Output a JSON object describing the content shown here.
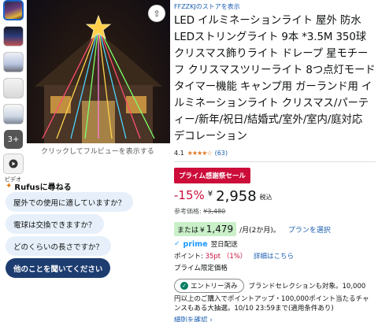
{
  "thumbnails": {
    "more_count": "3+",
    "video_label": "ビデオ"
  },
  "main_image": {
    "caption": "クリックしてフルビューを表示する"
  },
  "rufus": {
    "title": "Rufusに尋ねる",
    "questions": [
      "屋外での使用に適していますか？",
      "電球は交換できますか？",
      "どのくらいの長さですか？"
    ],
    "ask_other": "他のことを聞いてください"
  },
  "product": {
    "store_link": "FFZZKJのストアを表示",
    "title": "LED イルミネーションライト 屋外 防水 LEDストリングライト 9本 *3.5M 350球 クリスマス飾りライト ドレープ 星モチーフ クリスマスツリーライト 8つ点灯モード タイマー機能 キャンプ用 ガーランド用 イルミネーションライト クリスマス/パーティー/新年/祝日/結婚式/室外/室内/庭対応 デコレーション",
    "rating": "4.1",
    "stars_icon": "★★★★☆",
    "review_count": "(63)"
  },
  "pricing": {
    "deal_badge": "プライム感謝祭セール",
    "discount": "-15%",
    "currency": "¥",
    "price": "2,958",
    "tax_label": "税込",
    "reference_label": "参考価格:",
    "reference_price": "¥3,480",
    "installment_prefix": "または",
    "installment_currency": "¥",
    "installment_amount": "1,479",
    "installment_suffix": "/月(2か月)。",
    "plan_link": "プランを選択"
  },
  "prime": {
    "logo_text": "prime",
    "delivery": "翌日配送",
    "points_label": "ポイント:",
    "points_value": "35pt （1%）",
    "points_detail_link": "詳細はこちら",
    "prime_price_label": "プライム限定価格"
  },
  "entry": {
    "badge_label": "エントリー済み",
    "brand_text": "ブランドセレクションも対象。10,000",
    "description": "円以上のご購入でポイントアップ・100,000ポイント当たるチャンスもある大抽選。10/10 23:59まで(適用条件あり)",
    "details_link": "細則を確認 ›"
  },
  "colors": {
    "accent_blue": "#1a5eb0",
    "deal_red": "#cc0c39",
    "rufus_dark": "#1d3d70",
    "chip_bg": "#e7f0fa"
  }
}
